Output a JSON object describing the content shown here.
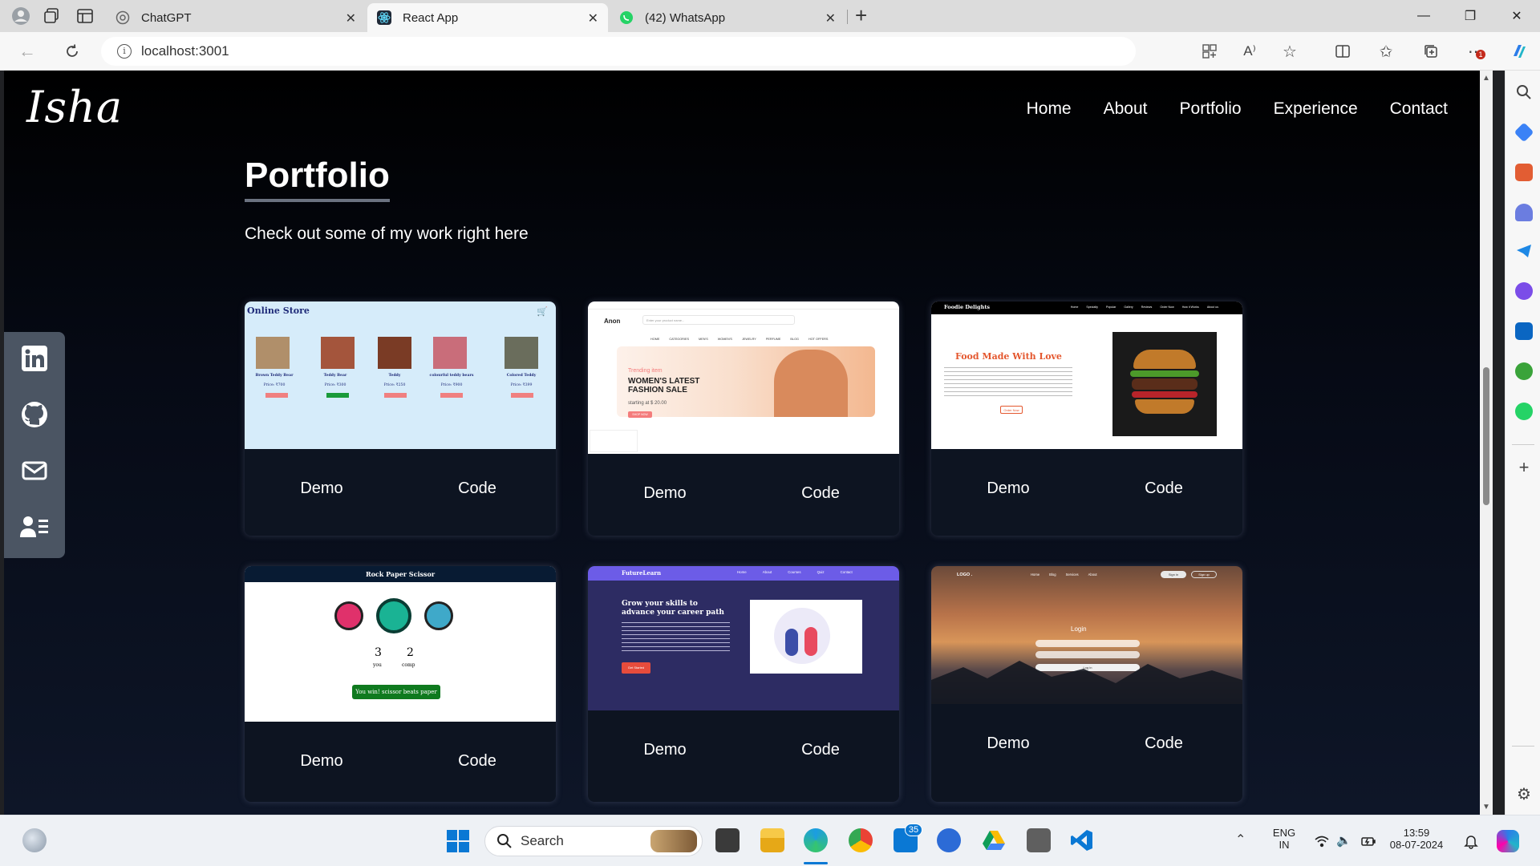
{
  "browser": {
    "tabs": [
      {
        "title": "ChatGPT",
        "icon": "chatgpt-icon"
      },
      {
        "title": "React App",
        "icon": "react-icon"
      },
      {
        "title": "(42) WhatsApp",
        "icon": "whatsapp-icon"
      }
    ],
    "url": "localhost:3001"
  },
  "site": {
    "logo": "Isha",
    "nav": [
      "Home",
      "About",
      "Portfolio",
      "Experience",
      "Contact"
    ],
    "section_title": "Portfolio",
    "section_subtitle": "Check out some of my work right here",
    "social": [
      "linkedin-icon",
      "github-icon",
      "mail-icon",
      "resume-icon"
    ],
    "cards": [
      {
        "demo": "Demo",
        "code": "Code"
      },
      {
        "demo": "Demo",
        "code": "Code"
      },
      {
        "demo": "Demo",
        "code": "Code"
      },
      {
        "demo": "Demo",
        "code": "Code"
      },
      {
        "demo": "Demo",
        "code": "Code"
      },
      {
        "demo": "Demo",
        "code": "Code"
      }
    ],
    "previews": {
      "store": {
        "title": "Online Store",
        "items": [
          {
            "name": "Brown Teddy Bear",
            "price": "Price: ₹700"
          },
          {
            "name": "Teddy Bear",
            "price": "Price: ₹300"
          },
          {
            "name": "Teddy",
            "price": "Price: ₹250"
          },
          {
            "name": "colourful teddy bears",
            "price": "Price: ₹900"
          },
          {
            "name": "Colored Teddy",
            "price": "Price: ₹399"
          }
        ]
      },
      "anon": {
        "brand": "Anon",
        "search_placeholder": "Enter your product name...",
        "menu": [
          "HOME",
          "CATEGORIES",
          "MEN'S",
          "WOMEN'S",
          "JEWELRY",
          "PERFUME",
          "BLOG",
          "HOT OFFERS"
        ],
        "trending": "Trending item",
        "headline": "WOMEN'S LATEST FASHION SALE",
        "price": "starting at $ 20.00",
        "cta": "SHOP NOW"
      },
      "foodie": {
        "brand": "Foodie Delights",
        "nav": [
          "Home",
          "Specialty",
          "Popular",
          "Gallery",
          "Reviews",
          "Order Now",
          "How it Works",
          "About us"
        ],
        "headline": "Food Made With Love",
        "cta": "Order Now"
      },
      "rps": {
        "title": "Rock Paper Scissor",
        "you_score": "3",
        "comp_score": "2",
        "you_label": "you",
        "comp_label": "comp",
        "message": "You win! scissor beats paper"
      },
      "futurelearn": {
        "brand": "FutureLearn",
        "nav": [
          "Home",
          "About",
          "Courses",
          "Quiz",
          "Contact"
        ],
        "headline": "Grow your skills to advance your career path",
        "cta": "Get Started"
      },
      "login": {
        "logo": "LOGO .",
        "nav": [
          "Home",
          "Blog",
          "Services",
          "About"
        ],
        "signin": "Sign in",
        "signup": "Sign up",
        "title": "Login",
        "button": "Log in"
      }
    }
  },
  "taskbar": {
    "search": "Search",
    "mail_badge": "35",
    "lang_top": "ENG",
    "lang_bottom": "IN",
    "time": "13:59",
    "date": "08-07-2024"
  }
}
